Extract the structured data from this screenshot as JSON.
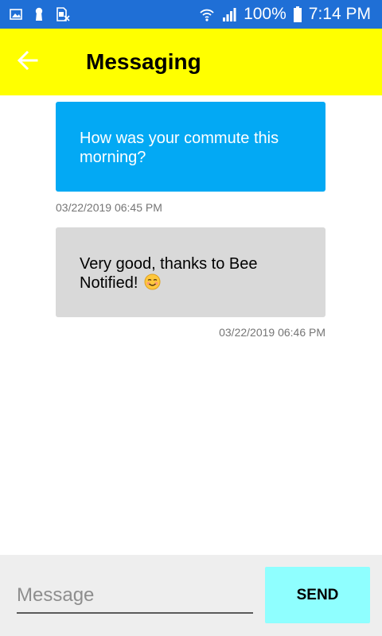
{
  "status_bar": {
    "battery": "100%",
    "time": "7:14 PM"
  },
  "app_bar": {
    "title": "Messaging"
  },
  "messages": [
    {
      "direction": "outgoing",
      "text": "How was your commute this morning?",
      "timestamp": "03/22/2019 06:45 PM"
    },
    {
      "direction": "incoming",
      "text": "Very good, thanks to Bee Notified!",
      "emoji": "smiling-face-icon",
      "timestamp": "03/22/2019 06:46 PM"
    }
  ],
  "composer": {
    "placeholder": "Message",
    "send_label": "SEND"
  },
  "colors": {
    "status_bar": "#1f6fd6",
    "app_bar": "#ffff00",
    "outgoing_bubble": "#03a9f4",
    "incoming_bubble": "#d9d9d9",
    "send_button": "#8fffff"
  }
}
